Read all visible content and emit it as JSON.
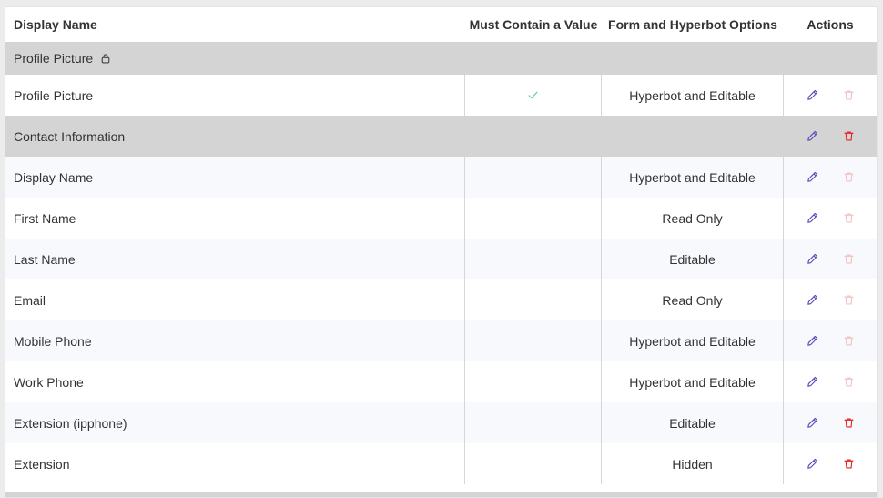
{
  "table": {
    "headers": {
      "display_name": "Display Name",
      "must_contain": "Must Contain a Value",
      "options": "Form and Hyperbot Options",
      "actions": "Actions"
    },
    "groups": [
      {
        "name": "Profile Picture",
        "locked": true,
        "rows": [
          {
            "name": "Profile Picture",
            "required": true,
            "option": "Hyperbot and Editable",
            "delete_enabled": false
          }
        ]
      },
      {
        "name": "Contact Information",
        "locked": false,
        "rows": [
          {
            "name": "Display Name",
            "required": false,
            "option": "Hyperbot and Editable",
            "delete_enabled": false
          },
          {
            "name": "First Name",
            "required": false,
            "option": "Read Only",
            "delete_enabled": false
          },
          {
            "name": "Last Name",
            "required": false,
            "option": "Editable",
            "delete_enabled": false
          },
          {
            "name": "Email",
            "required": false,
            "option": "Read Only",
            "delete_enabled": false
          },
          {
            "name": "Mobile Phone",
            "required": false,
            "option": "Hyperbot and Editable",
            "delete_enabled": false
          },
          {
            "name": "Work Phone",
            "required": false,
            "option": "Hyperbot and Editable",
            "delete_enabled": false
          },
          {
            "name": "Extension (ipphone)",
            "required": false,
            "option": "Editable",
            "delete_enabled": true
          },
          {
            "name": "Extension",
            "required": false,
            "option": "Hidden",
            "delete_enabled": true
          }
        ]
      }
    ]
  },
  "colors": {
    "edit_icon": "#5b4bb7",
    "delete_icon_active": "#e02424",
    "delete_icon_disabled": "#f3c2c2",
    "check_icon": "#5ec9a6",
    "group_row_bg": "#d4d4d4",
    "alt_row_bg": "#f8f9fc"
  },
  "icons": {
    "edit": "pencil-icon",
    "delete": "trash-icon",
    "lock": "lock-icon",
    "check": "check-icon"
  }
}
